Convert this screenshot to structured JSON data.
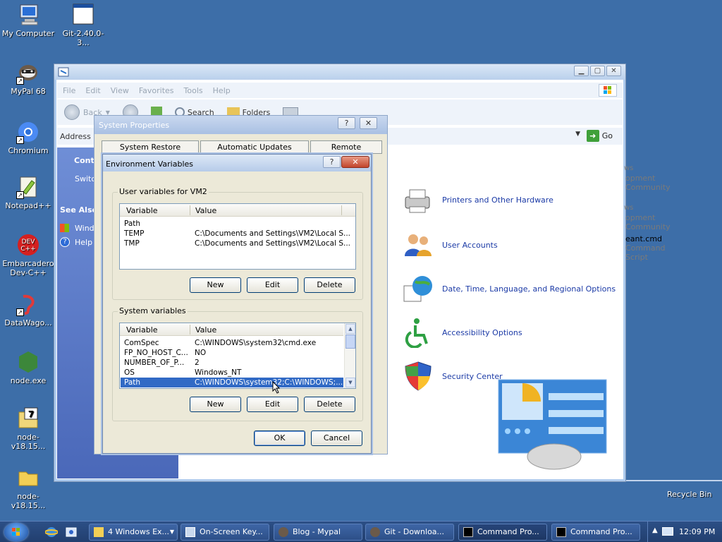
{
  "desktop": {
    "icons": [
      {
        "label": "My Computer"
      },
      {
        "label": "Git-2.40.0-3..."
      },
      {
        "label": "MyPal 68"
      },
      {
        "label": "Chromium"
      },
      {
        "label": "Notepad++"
      },
      {
        "label": "Embarcadero Dev-C++"
      },
      {
        "label": "DataWago..."
      },
      {
        "label": "node.exe"
      },
      {
        "label": "node-v18.15..."
      },
      {
        "label": "node-v18.15..."
      }
    ],
    "recycle_bin": "Recycle Bin"
  },
  "explorer": {
    "menu": [
      "File",
      "Edit",
      "View",
      "Favorites",
      "Tools",
      "Help"
    ],
    "toolbar": {
      "back": "Back",
      "search": "Search",
      "folders": "Folders"
    },
    "address_label": "Address",
    "go_label": "Go",
    "left_pane": {
      "control_header": "Contr",
      "switch_item": "Switc",
      "see_also": "See Also",
      "windows_item": "Wind",
      "help_item": "Help"
    },
    "categories": [
      {
        "label": "Printers and Other Hardware",
        "icon": "printer-icon"
      },
      {
        "label": "User Accounts",
        "icon": "user-accounts-icon"
      },
      {
        "label": "Date, Time, Language, and Regional Options",
        "icon": "globe-calendar-icon"
      },
      {
        "label": "Accessibility Options",
        "icon": "accessibility-icon"
      },
      {
        "label": "Security Center",
        "icon": "shield-icon"
      }
    ],
    "right_fragments": {
      "f1": "ws",
      "f2": "opment Community",
      "f3": "ws",
      "f4": "opment Community",
      "f5": "eant.cmd",
      "f6": "Command Script"
    }
  },
  "system_properties": {
    "title": "System Properties",
    "tabs": [
      "System Restore",
      "Automatic Updates",
      "Remote"
    ],
    "help": "?",
    "close": "✕"
  },
  "env_dialog": {
    "title": "Environment Variables",
    "help": "?",
    "close": "✕",
    "user_group": "User variables for VM2",
    "system_group": "System variables",
    "columns": {
      "variable": "Variable",
      "value": "Value"
    },
    "user_vars": [
      {
        "variable": "Path",
        "value": ""
      },
      {
        "variable": "TEMP",
        "value": "C:\\Documents and Settings\\VM2\\Local S..."
      },
      {
        "variable": "TMP",
        "value": "C:\\Documents and Settings\\VM2\\Local S..."
      }
    ],
    "system_vars": [
      {
        "variable": "ComSpec",
        "value": "C:\\WINDOWS\\system32\\cmd.exe"
      },
      {
        "variable": "FP_NO_HOST_C...",
        "value": "NO"
      },
      {
        "variable": "NUMBER_OF_P...",
        "value": "2"
      },
      {
        "variable": "OS",
        "value": "Windows_NT"
      },
      {
        "variable": "Path",
        "value": "C:\\WINDOWS\\system32;C:\\WINDOWS;..."
      }
    ],
    "buttons": {
      "new": "New",
      "edit": "Edit",
      "delete": "Delete",
      "ok": "OK",
      "cancel": "Cancel"
    }
  },
  "taskbar": {
    "tasks": [
      {
        "label": "4 Windows Ex..."
      },
      {
        "label": "On-Screen Key..."
      },
      {
        "label": "Blog - Mypal"
      },
      {
        "label": "Git - Downloa..."
      },
      {
        "label": "Command Pro..."
      },
      {
        "label": "Command Pro..."
      }
    ],
    "clock": "12:09 PM"
  },
  "colors": {
    "desktop": "#3d6ea8",
    "selection": "#316ac5",
    "link": "#1b3aa6",
    "dialog_face": "#ece9d8"
  }
}
